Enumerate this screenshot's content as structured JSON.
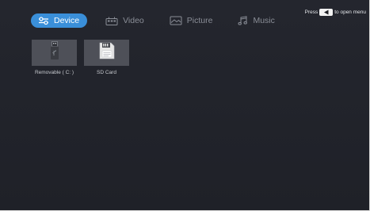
{
  "hint": {
    "prefix": "Press",
    "suffix": "to open menu",
    "key_icon": "left-arrow-key-icon"
  },
  "tabs": [
    {
      "label": "Device",
      "icon": "device-toggle-icon",
      "active": true
    },
    {
      "label": "Video",
      "icon": "video-icon",
      "active": false
    },
    {
      "label": "Picture",
      "icon": "picture-icon",
      "active": false
    },
    {
      "label": "Music",
      "icon": "music-icon",
      "active": false
    }
  ],
  "devices": [
    {
      "label": "Removable ( C: )",
      "icon": "usb-drive-icon"
    },
    {
      "label": "SD Card",
      "icon": "sd-card-icon"
    }
  ],
  "colors": {
    "accent": "#3a8fd9",
    "background": "#202229",
    "tile": "#4e5058"
  }
}
